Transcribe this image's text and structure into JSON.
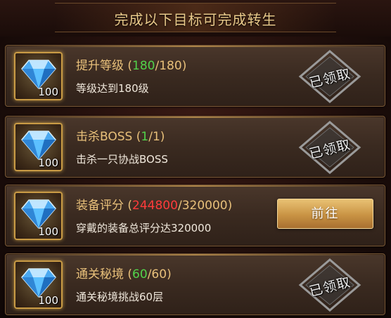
{
  "header": {
    "title": "完成以下目标可完成转生"
  },
  "tasks": [
    {
      "name": "提升等级",
      "current": "180",
      "total": "180",
      "desc": "等级达到180级",
      "reward_count": "100",
      "status": "已领取",
      "current_color": "#52d34a"
    },
    {
      "name": "击杀BOSS",
      "current": "1",
      "total": "1",
      "desc": "击杀一只协战BOSS",
      "reward_count": "100",
      "status": "已领取",
      "current_color": "#52d34a"
    },
    {
      "name": "装备评分",
      "current": "244800",
      "total": "320000",
      "desc": "穿戴的装备总评分达320000",
      "reward_count": "100",
      "button": "前往",
      "current_color": "#ff3b3b"
    },
    {
      "name": "通关秘境",
      "current": "60",
      "total": "60",
      "desc": "通关秘境挑战60层",
      "reward_count": "100",
      "status": "已领取",
      "current_color": "#52d34a"
    }
  ],
  "icons": {
    "reward": "diamond-icon",
    "stamp": "claimed-stamp-icon"
  }
}
